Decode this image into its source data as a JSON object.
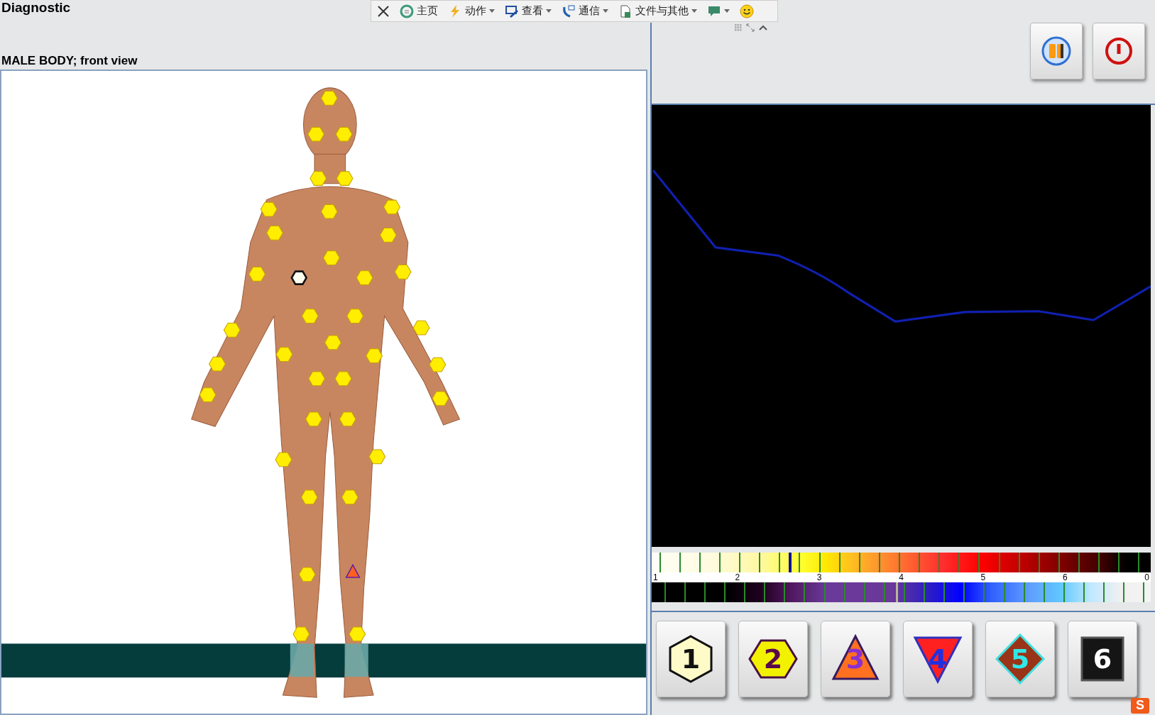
{
  "window": {
    "title": "Diagnostic"
  },
  "toolbar": {
    "items": [
      {
        "label": "主页",
        "dropdown": false
      },
      {
        "label": "动作",
        "dropdown": true
      },
      {
        "label": "查看",
        "dropdown": true
      },
      {
        "label": "通信",
        "dropdown": true
      },
      {
        "label": "文件与其他",
        "dropdown": true
      },
      {
        "dropdown": true
      }
    ]
  },
  "body_view": {
    "title": "MALE BODY; front view"
  },
  "spectrum": {
    "scale": [
      "1",
      "2",
      "3",
      "4",
      "5",
      "6",
      "0"
    ]
  },
  "level_buttons": [
    {
      "label": "1",
      "kind": "pale-hexagon"
    },
    {
      "label": "2",
      "kind": "hexagon"
    },
    {
      "label": "3",
      "kind": "triangle"
    },
    {
      "label": "4",
      "kind": "inverted-triangle"
    },
    {
      "label": "5",
      "kind": "diamond"
    },
    {
      "label": "6",
      "kind": "square"
    }
  ],
  "ime_indicator": {
    "label": "S"
  }
}
